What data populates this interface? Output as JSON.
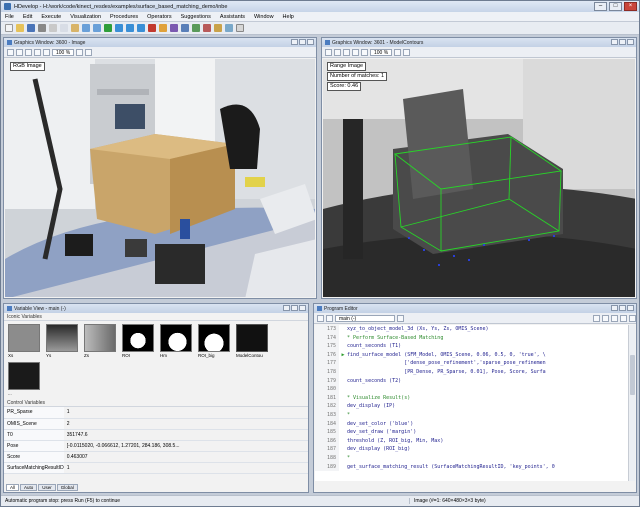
{
  "window": {
    "title": "HDevelop - H:/work/code/kinect_resdes/examples/surface_based_matching_demo/inbe"
  },
  "menu": [
    "File",
    "Edit",
    "Execute",
    "Visualization",
    "Procedures",
    "Operators",
    "Suggestions",
    "Assistants",
    "Window",
    "Help"
  ],
  "graphics_left": {
    "title": "Graphics Window: 3600 - Image",
    "zoom": "100 %",
    "label": "RGB Image"
  },
  "graphics_right": {
    "title": "Graphics Window: 3601 - ModelContours",
    "zoom": "100 %",
    "labels": [
      "Range Image",
      "Number of matches: 1",
      "Score: 0.46"
    ]
  },
  "variable_view": {
    "title": "Variable View - main (-)",
    "iconic_header": "Iconic Variables",
    "thumbs": [
      "Xs",
      "Ys",
      "Zs",
      "ROI",
      "Hm",
      "ROI_big",
      "ModelContou",
      "..."
    ],
    "control_header": "Control Variables",
    "control_rows": [
      {
        "name": "PR_Sparse",
        "value": "1"
      },
      {
        "name": "OMIS_Scene",
        "value": "2"
      },
      {
        "name": "T0",
        "value": "351747.6"
      },
      {
        "name": "Pose",
        "value": "[-0.0115020, -0.066612, 1.27201, 284.186, 308.5..."
      },
      {
        "name": "Score",
        "value": "0.463007"
      },
      {
        "name": "SurfaceMatchingResultID",
        "value": "1"
      }
    ],
    "tabs": [
      "All",
      "Auto",
      "User",
      "Global"
    ]
  },
  "program_editor": {
    "title": "Program Editor",
    "procedure": "main (-)",
    "lines": [
      {
        "n": "173",
        "m": "",
        "t": "xyz_to_object_model_3d (Xs, Ys, Zs, OMIS_Scene)",
        "c": false
      },
      {
        "n": "174",
        "m": "",
        "t": "* Perform Surface-Based Matching",
        "c": true
      },
      {
        "n": "175",
        "m": "",
        "t": "count_seconds (T1)",
        "c": false
      },
      {
        "n": "176",
        "m": "▶",
        "t": "find_surface_model (SFM_Model, OMIS_Scene, 0.06, 0.5, 0, 'true', \\",
        "c": false
      },
      {
        "n": "177",
        "m": "",
        "t": "                   ['dense_pose_refinement','sparse_pose_refinemen",
        "c": false
      },
      {
        "n": "178",
        "m": "",
        "t": "                   [PR_Dense, PR_Sparse, 0.01], Pose, Score, Surfa",
        "c": false
      },
      {
        "n": "179",
        "m": "",
        "t": "count_seconds (T2)",
        "c": false
      },
      {
        "n": "180",
        "m": "",
        "t": "",
        "c": false
      },
      {
        "n": "181",
        "m": "",
        "t": "* Visualize Result(s)",
        "c": true
      },
      {
        "n": "182",
        "m": "",
        "t": "dev_display (IP)",
        "c": false
      },
      {
        "n": "183",
        "m": "",
        "t": "*",
        "c": true
      },
      {
        "n": "184",
        "m": "",
        "t": "dev_set_color ('blue')",
        "c": false
      },
      {
        "n": "185",
        "m": "",
        "t": "dev_set_draw ('margin')",
        "c": false
      },
      {
        "n": "186",
        "m": "",
        "t": "threshold (Z, ROI_big, Min, Max)",
        "c": false
      },
      {
        "n": "187",
        "m": "",
        "t": "dev_display (ROI_big)",
        "c": false
      },
      {
        "n": "188",
        "m": "",
        "t": "*",
        "c": true
      },
      {
        "n": "189",
        "m": "",
        "t": "get_surface_matching_result (SurfaceMatchingResultID, 'key_points', 0",
        "c": false
      }
    ]
  },
  "status": {
    "message": "Automatic program stop: press Run (F5) to continue",
    "image": "Image (#=1: 640×480×3×3 byte)",
    "coords": "",
    "lock": ""
  }
}
